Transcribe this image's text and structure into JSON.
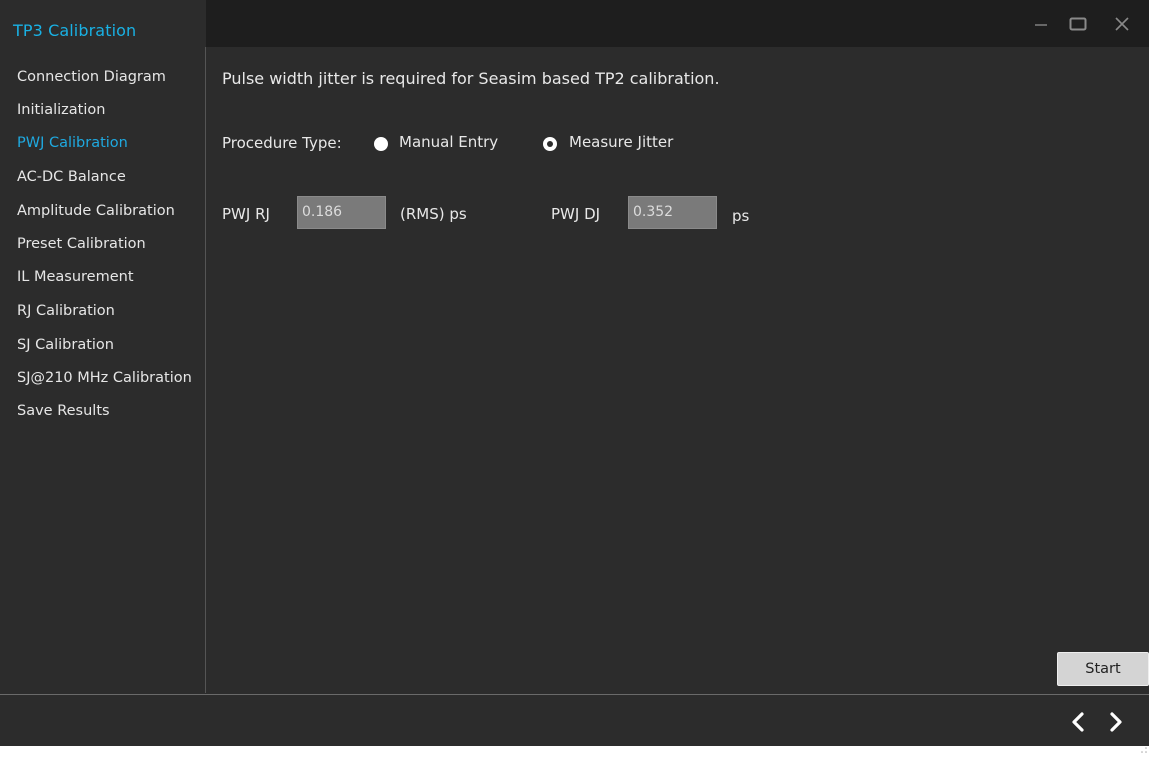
{
  "window": {
    "title": "TP3 Calibration",
    "accent_color": "#19b1e4",
    "controls": [
      "minimize-icon",
      "maximize-icon",
      "close-icon"
    ]
  },
  "sidebar": {
    "items": [
      {
        "label": "Connection Diagram",
        "active": false
      },
      {
        "label": "Initialization",
        "active": false
      },
      {
        "label": "PWJ Calibration",
        "active": true
      },
      {
        "label": "AC-DC Balance",
        "active": false
      },
      {
        "label": "Amplitude Calibration",
        "active": false
      },
      {
        "label": "Preset Calibration",
        "active": false
      },
      {
        "label": "IL Measurement",
        "active": false
      },
      {
        "label": "RJ Calibration",
        "active": false
      },
      {
        "label": "SJ Calibration",
        "active": false
      },
      {
        "label": "SJ@210 MHz Calibration",
        "active": false
      },
      {
        "label": "Save Results",
        "active": false
      }
    ]
  },
  "main": {
    "intro_text": "Pulse width jitter is required for Seasim based TP2 calibration.",
    "procedure": {
      "label": "Procedure Type:",
      "options": [
        {
          "label": "Manual Entry",
          "selected": false
        },
        {
          "label": "Measure Jitter",
          "selected": true
        }
      ]
    },
    "pwj_rj": {
      "label": "PWJ RJ",
      "value": "0.186",
      "unit": "(RMS) ps"
    },
    "pwj_dj": {
      "label": "PWJ DJ",
      "value": "0.352",
      "unit": "ps"
    },
    "start_label": "Start"
  },
  "footer": {
    "icons": [
      "chevron-left-icon",
      "chevron-right-icon"
    ]
  }
}
